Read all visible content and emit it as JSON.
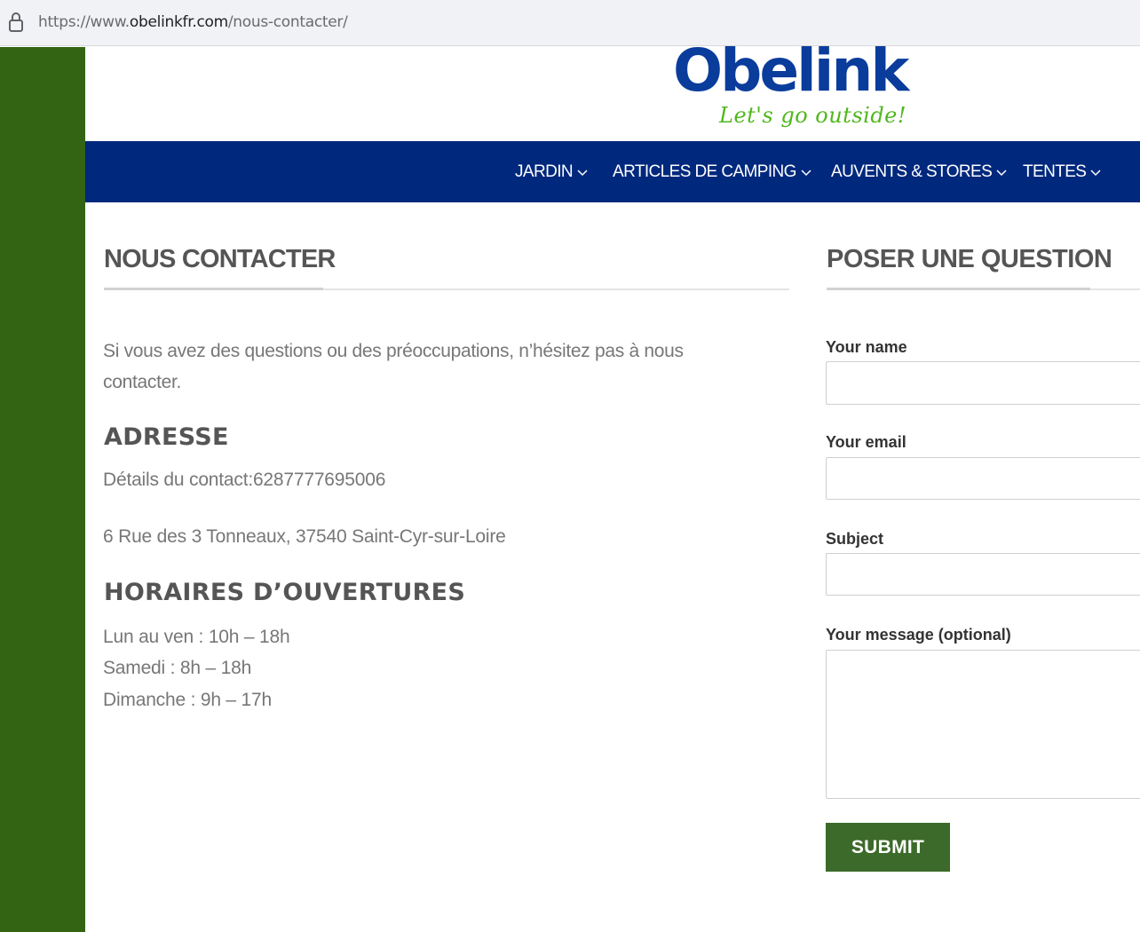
{
  "browser": {
    "url_prefix": "https://www.",
    "url_host": "obelinkfr.com",
    "url_path": "/nous-contacter/"
  },
  "header": {
    "logo_text": "Obelink",
    "logo_tagline": "Let's go outside!",
    "logo_color": "#0a3c9c",
    "tagline_color": "#4fb81c"
  },
  "nav": {
    "background": "#00287d",
    "items": [
      {
        "label": "JARDIN"
      },
      {
        "label": "ARTICLES DE CAMPING"
      },
      {
        "label": "AUVENTS & STORES"
      },
      {
        "label": "TENTES"
      }
    ]
  },
  "contact": {
    "title": "NOUS CONTACTER",
    "intro": "Si vous avez des questions ou des préoccupations, n’hésitez pas à nous contacter.",
    "address_heading": "ADRESSE",
    "contact_details": "Détails du contact:6287777695006",
    "address": "6 Rue des 3 Tonneaux, 37540 Saint-Cyr-sur-Loire",
    "hours_heading": "HORAIRES D’OUVERTURES",
    "hours": [
      "Lun au ven : 10h – 18h",
      "Samedi : 8h – 18h",
      "Dimanche : 9h – 17h"
    ]
  },
  "form": {
    "title": "POSER UNE QUESTION",
    "name_label": "Your name",
    "name_value": "",
    "email_label": "Your email",
    "email_value": "",
    "subject_label": "Subject",
    "subject_value": "",
    "message_label": "Your message (optional)",
    "message_value": "",
    "submit_label": "SUBMIT",
    "submit_color": "#3c6a2a"
  },
  "sidebar_color": "#336414"
}
